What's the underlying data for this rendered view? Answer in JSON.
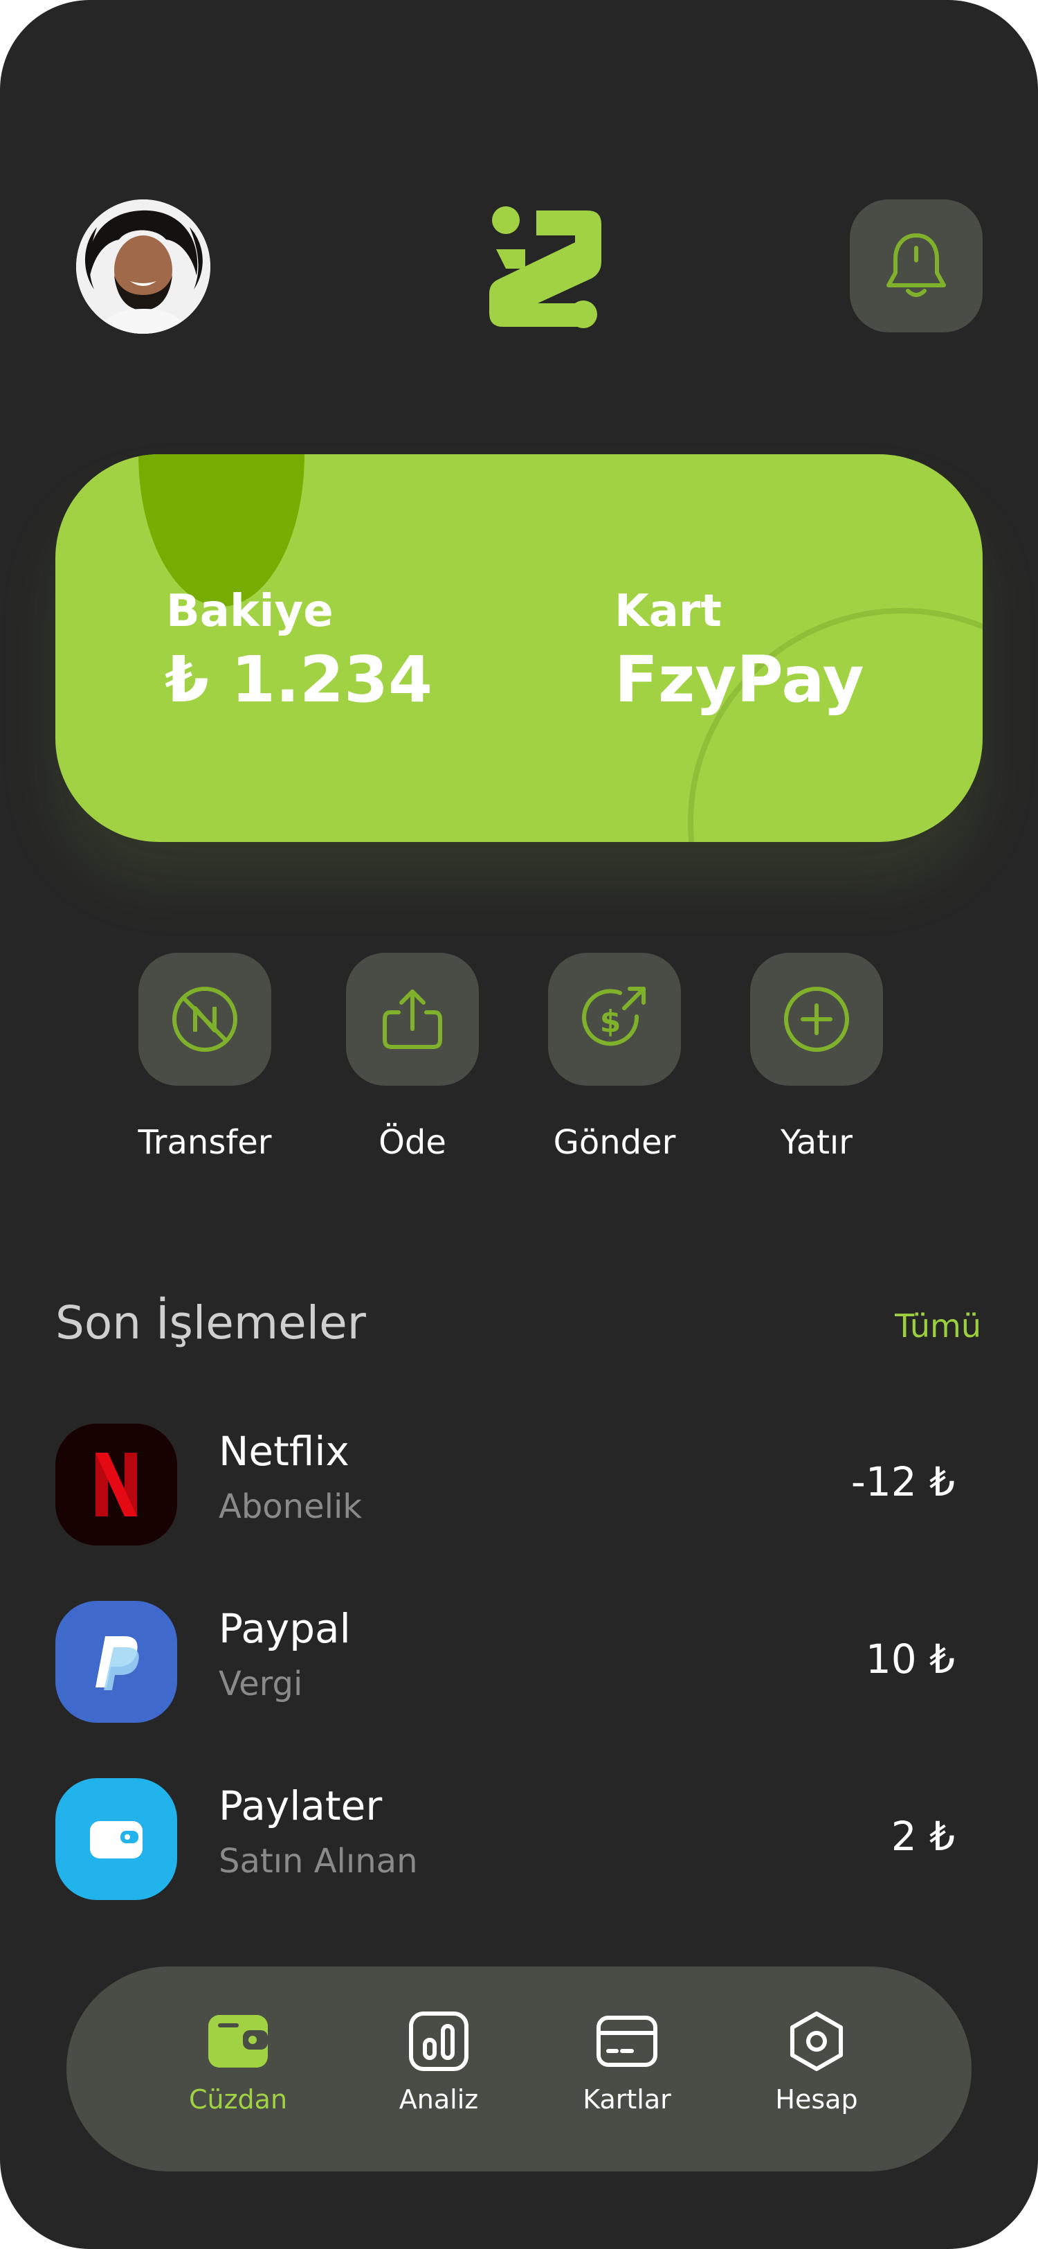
{
  "colors": {
    "background": "#262626",
    "accent": "#a1d243",
    "accent_dark": "#77ad00",
    "surface": "#4a4c46",
    "text_primary": "#ffffff",
    "text_muted": "#8a8a8a"
  },
  "header": {
    "avatar_icon": "user-avatar",
    "logo_icon": "fzypay-logo",
    "bell_icon": "bell-icon"
  },
  "card": {
    "balance_label": "Bakiye",
    "balance_value": "₺ 1.234",
    "card_label": "Kart",
    "card_value": "FzyPay"
  },
  "actions": [
    {
      "label": "Transfer",
      "icon": "transfer-icon"
    },
    {
      "label": "Öde",
      "icon": "share-upload-icon"
    },
    {
      "label": "Gönder",
      "icon": "send-dollar-icon"
    },
    {
      "label": "Yatır",
      "icon": "plus-icon"
    }
  ],
  "transactions_section": {
    "title": "Son İşlemeler",
    "see_all": "Tümü"
  },
  "transactions": [
    {
      "name": "Netflix",
      "subtitle": "Abonelik",
      "amount": "-12 ₺",
      "icon": "netflix-icon",
      "icon_bg": "#170202"
    },
    {
      "name": "Paypal",
      "subtitle": "Vergi",
      "amount": "10 ₺",
      "icon": "paypal-icon",
      "icon_bg": "#4069cc"
    },
    {
      "name": "Paylater",
      "subtitle": "Satın Alınan",
      "amount": "2 ₺",
      "icon": "wallet-icon",
      "icon_bg": "#23b3ec"
    }
  ],
  "bottom_nav": [
    {
      "label": "Cüzdan",
      "icon": "wallet-icon",
      "active": true
    },
    {
      "label": "Analiz",
      "icon": "bar-chart-icon",
      "active": false
    },
    {
      "label": "Kartlar",
      "icon": "credit-card-icon",
      "active": false
    },
    {
      "label": "Hesap",
      "icon": "settings-hex-icon",
      "active": false
    }
  ]
}
